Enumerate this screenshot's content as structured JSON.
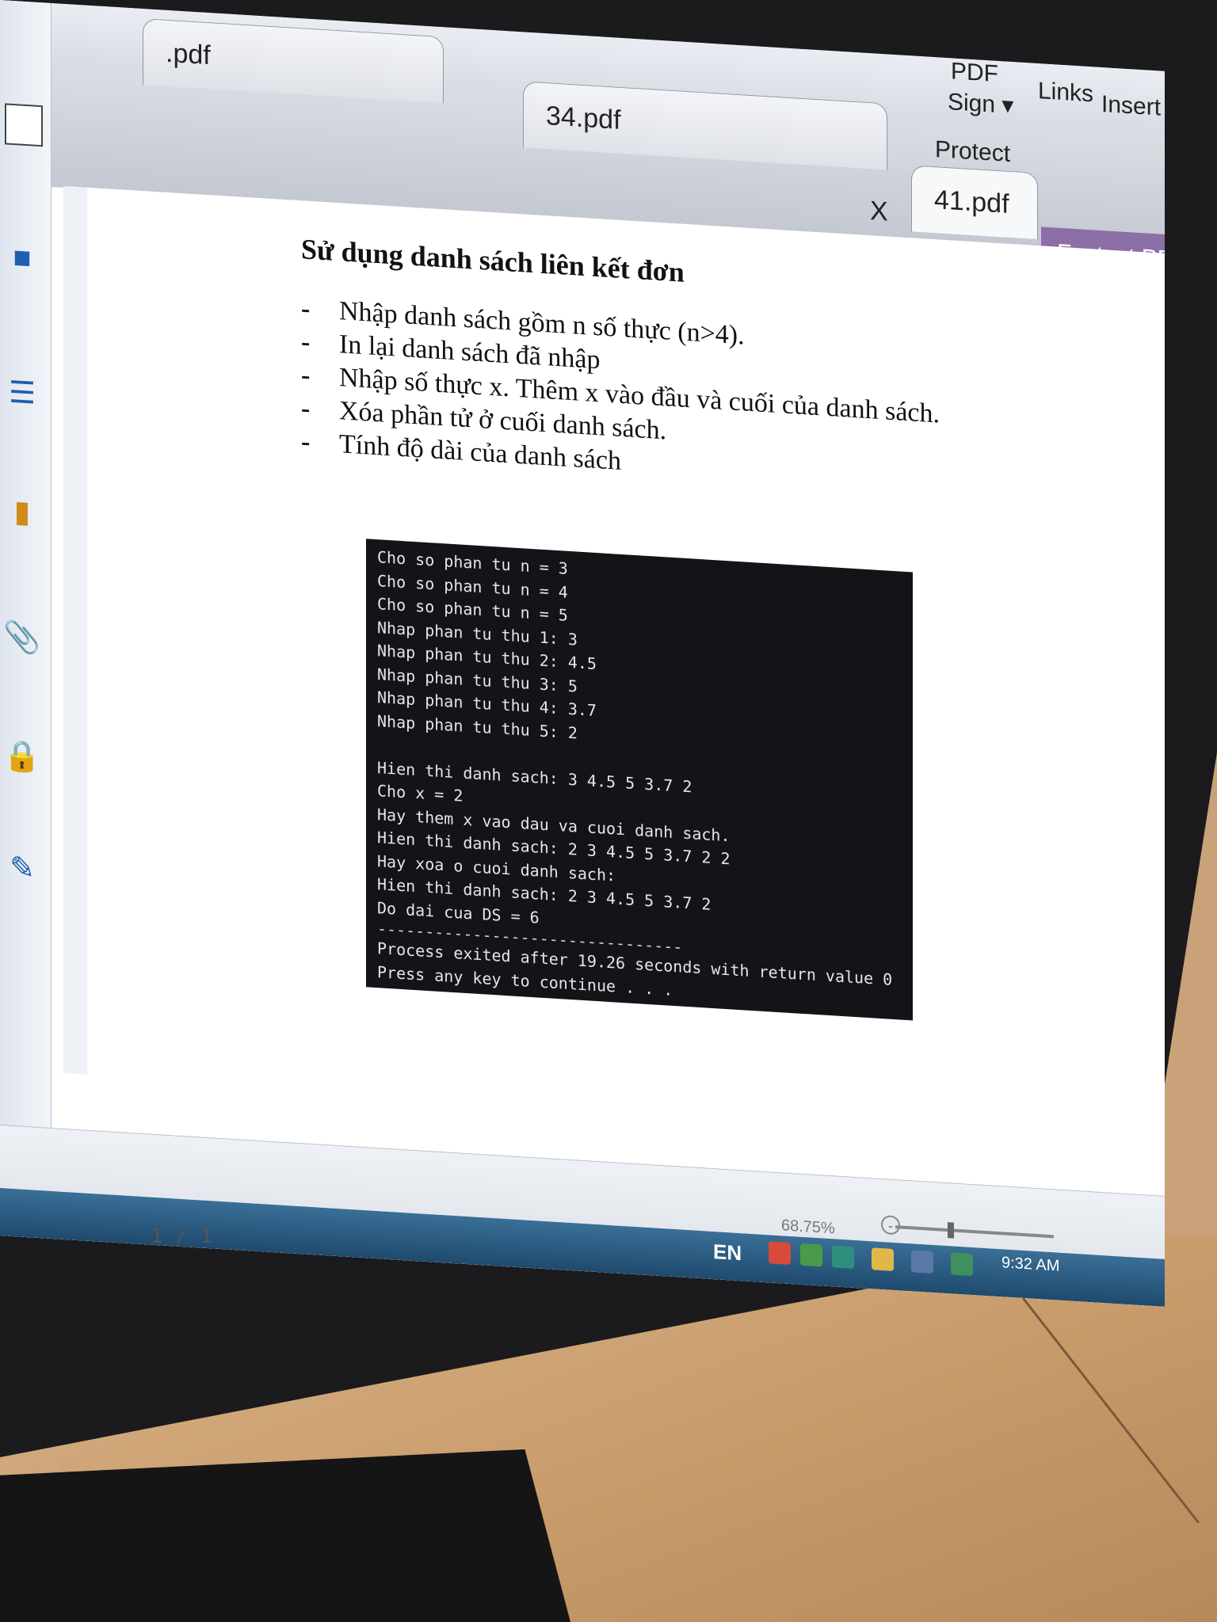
{
  "toolbar": {
    "pdf_label": "PDF",
    "sign_label": "Sign ▾",
    "links_label": "Links",
    "insert_label": "Insert",
    "protect_label": "Protect"
  },
  "tabs": [
    {
      "label": ".pdf"
    },
    {
      "label": "34.pdf"
    },
    {
      "label": "41.pdf"
    }
  ],
  "tab_close_label": "X",
  "search": {
    "label": "Fastest PDF Searc"
  },
  "document": {
    "title": "Sử dụng danh sách liên kết đơn",
    "bullets": [
      "Nhập danh sách gồm n số thực (n>4).",
      "In lại danh sách đã nhập",
      "Nhập số thực x. Thêm x vào đầu và cuối của danh sách.",
      "Xóa phần tử ở cuối danh sách.",
      "Tính độ dài của danh sách"
    ]
  },
  "console": {
    "lines_top": [
      "Cho so phan tu n = 3",
      "Cho so phan tu n = 4",
      "Cho so phan tu n = 5",
      "Nhap phan tu thu 1: 3",
      "Nhap phan tu thu 2: 4.5",
      "Nhap phan tu thu 3: 5",
      "Nhap phan tu thu 4: 3.7",
      "Nhap phan tu thu 5: 2"
    ],
    "lines_bottom": [
      "Hien thi danh sach: 3 4.5 5 3.7 2",
      "Cho x = 2",
      "Hay them x vao dau va cuoi danh sach.",
      "Hien thi danh sach: 2 3 4.5 5 3.7 2 2",
      "Hay xoa o cuoi danh sach:",
      "Hien thi danh sach: 2 3 4.5 5 3.7 2",
      "Do dai cua DS = 6"
    ],
    "separator": "--------------------------------",
    "exit_line": "Process exited after 19.26 seconds with return value 0",
    "press_line": "Press any key to continue . . ."
  },
  "status": {
    "page_indicator": "1 / 1",
    "zoom": "68.75%"
  },
  "taskbar": {
    "language": "EN",
    "time": "9:32 AM"
  },
  "colors": {
    "console_bg": "#121418",
    "search_bar": "#8d6fa8",
    "taskbar": "#1f4a6e"
  }
}
